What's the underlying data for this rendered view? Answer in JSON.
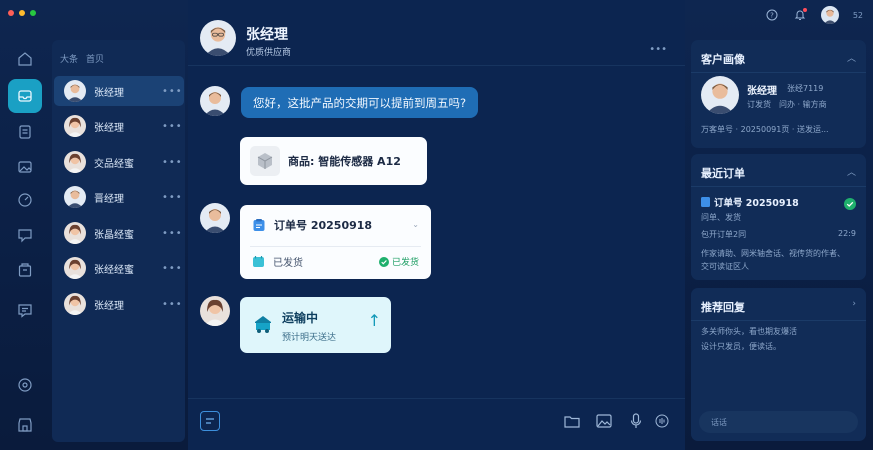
{
  "window": {
    "top_number": "52"
  },
  "list": {
    "header_left": "大条",
    "header_right": "首贝",
    "more": "•••",
    "items": [
      {
        "name": "张经理",
        "selected": true
      },
      {
        "name": "张经理",
        "selected": false
      },
      {
        "name": "交品经蜜",
        "selected": false
      },
      {
        "name": "晋经理",
        "selected": false
      },
      {
        "name": "张晶经蜜",
        "selected": false
      },
      {
        "name": "张经经蜜",
        "selected": false
      },
      {
        "name": "张经理",
        "selected": false
      }
    ]
  },
  "chat": {
    "name": "张经理",
    "subtitle": "优质供应商",
    "more": "•••",
    "question": "您好，这批产品的交期可以提前到周五吗?",
    "product_label": "商品: 智能传感器 A12",
    "order_label": "订单号 20250918",
    "order_status": "已发货",
    "order_badge": "已发货",
    "ship_title": "运输中",
    "ship_sub": "预计明天送达"
  },
  "profile": {
    "title": "客户画像",
    "name": "张经理",
    "extra": "张经7119",
    "line1": "订发货　问办 · 输方商",
    "line2": "万客单号 · 20250091页 · 送发运..."
  },
  "orders": {
    "title": "最近订单",
    "order_no": "订单号 20250918",
    "r1": "问单、发货",
    "r2": "包开订单2同",
    "r2_right": "22:9",
    "desc1": "作家请助、网米轴舍话、视传货的作者、",
    "desc2": "交可读证区人"
  },
  "replies": {
    "title": "推荐回复",
    "r1": "多关师你头，看也期友爆活",
    "r2": "设计只发员，便读话。",
    "input_placeholder": "话话"
  },
  "colors": {
    "accent": "#1aa0c4",
    "bubble": "#1f6db5",
    "success": "#1d9e63",
    "traffic": [
      "#ff5f57",
      "#febc2e",
      "#28c840"
    ]
  }
}
